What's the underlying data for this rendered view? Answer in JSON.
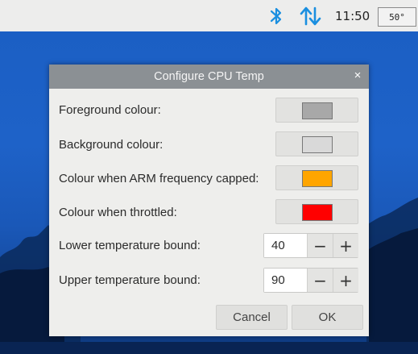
{
  "taskbar": {
    "bluetooth_icon": "bluetooth-icon",
    "network_icon": "network-updown-icon",
    "clock": "11:50",
    "cpu_temp": "50°",
    "accent_color": "#1a8fe0"
  },
  "dialog": {
    "title": "Configure CPU Temp",
    "close_icon": "×",
    "rows": {
      "foreground": {
        "label": "Foreground colour:",
        "color": "#a8a8a8"
      },
      "background": {
        "label": "Background colour:",
        "color": "#d9d9d9"
      },
      "arm_capped": {
        "label": "Colour when ARM frequency capped:",
        "color": "#ffa500"
      },
      "throttled": {
        "label": "Colour when throttled:",
        "color": "#ff0000"
      },
      "lower_bound": {
        "label": "Lower temperature bound:",
        "value": "40"
      },
      "upper_bound": {
        "label": "Upper temperature bound:",
        "value": "90"
      }
    },
    "spin": {
      "minus": "−",
      "plus": "+"
    },
    "buttons": {
      "cancel": "Cancel",
      "ok": "OK"
    }
  }
}
